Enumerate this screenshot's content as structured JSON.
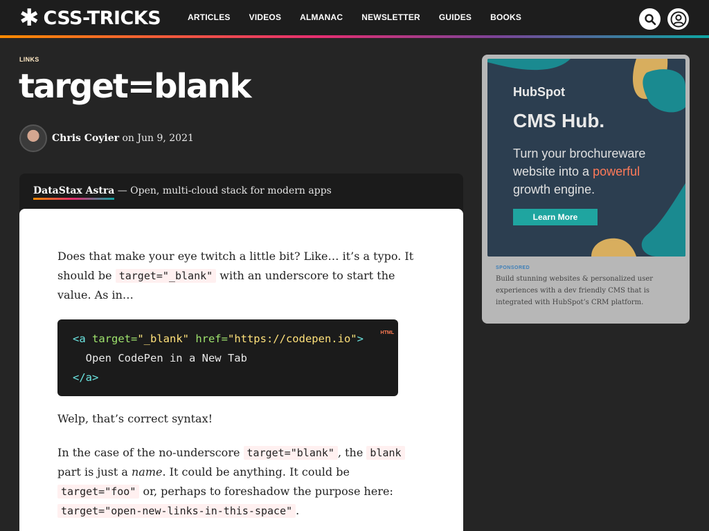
{
  "header": {
    "logo_symbol": "✱",
    "logo_text": "CSS-TRICKS",
    "nav": [
      "ARTICLES",
      "VIDEOS",
      "ALMANAC",
      "NEWSLETTER",
      "GUIDES",
      "BOOKS"
    ],
    "search_icon": "search-icon",
    "user_icon": "user-icon"
  },
  "article": {
    "category": "LINKS",
    "title": "target=blank",
    "author": "Chris Coyier",
    "date_prefix": "on",
    "date": "Jun 9, 2021"
  },
  "sponsor": {
    "brand": "DataStax Astra",
    "tagline": " — Open, multi-cloud stack for modern apps"
  },
  "content": {
    "p1_a": "Does that make your eye twitch a little bit? Like… it’s a typo. It should be ",
    "p1_code": "target=\"_blank\"",
    "p1_b": " with an underscore to start the value. As in…",
    "code_lang": "HTML",
    "code_line1_open": "<a",
    "code_line1_attr1": " target=",
    "code_line1_val1": "\"_blank\"",
    "code_line1_attr2": " href=",
    "code_line1_val2": "\"https://codepen.io\"",
    "code_line1_close": ">",
    "code_line2": "  Open CodePen in a New Tab",
    "code_line3": "</a>",
    "p2": "Welp, that’s correct syntax!",
    "p3_a": "In the case of the no-underscore ",
    "p3_code1": "target=\"blank\"",
    "p3_b": ", the ",
    "p3_code2": "blank",
    "p3_c": " part is just a ",
    "p3_em": "name",
    "p3_d": ". It could be anything. It could be ",
    "p3_code3": "target=\"foo\"",
    "p3_e": " or, perhaps to foreshadow the purpose here: ",
    "p3_code4": "target=\"open-new-links-in-this-space\"",
    "p3_f": "."
  },
  "ad": {
    "brand": "HubSpot",
    "headline": "CMS Hub.",
    "copy_a": "Turn your brochureware website into a ",
    "copy_hl": "powerful",
    "copy_b": " growth engine.",
    "button": "Learn More",
    "sponsored_label": "SPONSORED",
    "description": "Build stunning websites & personalized user experiences with a dev friendly CMS that is integrated with HubSpot’s CRM platform."
  }
}
